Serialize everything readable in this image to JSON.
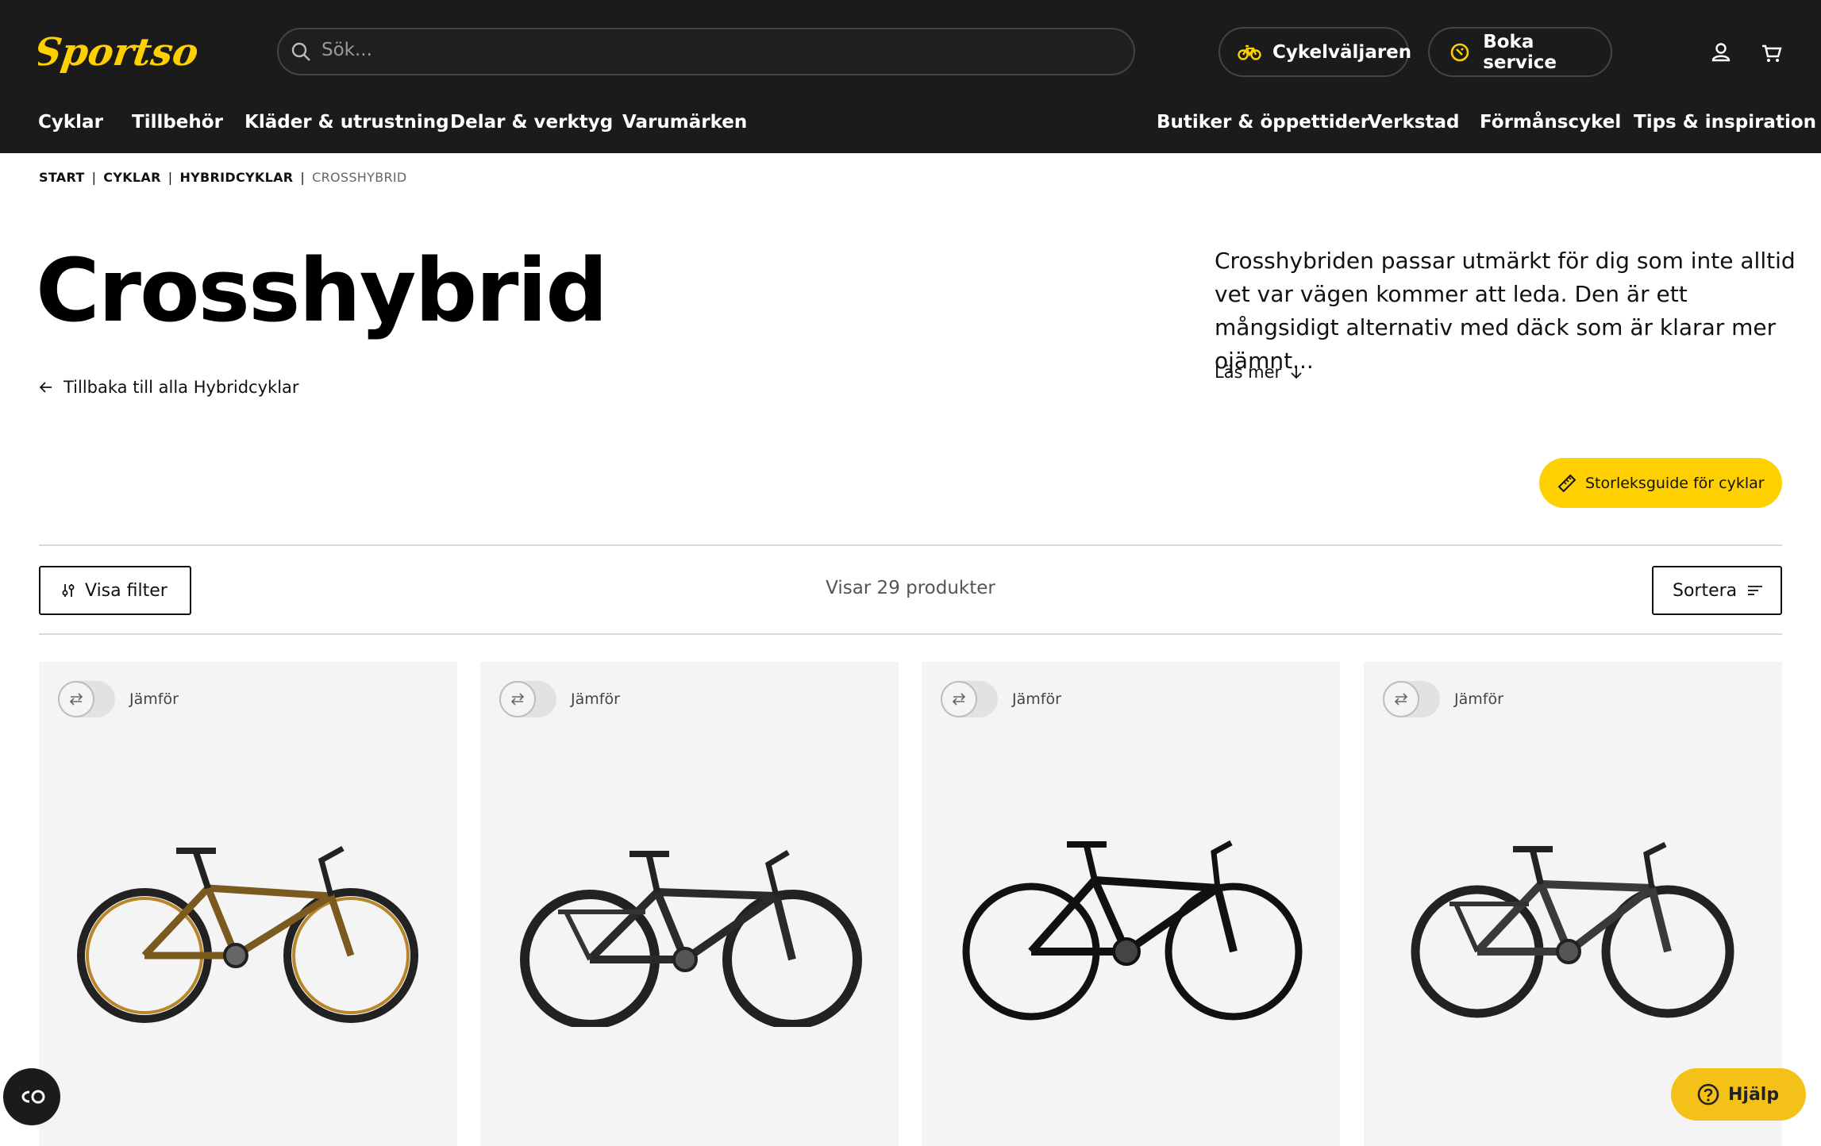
{
  "header": {
    "logo_text": "Sportson",
    "search_placeholder": "Sök...",
    "bike_finder_label": "Cykelväljaren",
    "book_service_label": "Boka service",
    "account_icon": "user-icon",
    "cart_icon": "cart-icon"
  },
  "nav_left": [
    "Cyklar",
    "Tillbehör",
    "Kläder & utrustning",
    "Delar & verktyg",
    "Varumärken"
  ],
  "nav_right": [
    "Butiker & öppettider",
    "Verkstad",
    "Förmånscykel",
    "Tips & inspiration"
  ],
  "breadcrumb": [
    "START",
    "CYKLAR",
    "HYBRIDCYKLAR",
    "CROSSHYBRID"
  ],
  "page": {
    "title": "Crosshybrid",
    "back_link": "Tillbaka till alla Hybridcyklar",
    "description": "Crosshybriden passar utmärkt för dig som inte alltid vet var vägen kommer att leda. Den är ett mångsidigt alternativ med däck som är klarar mer ojämnt...",
    "read_more": "Läs mer",
    "size_guide": "Storleksguide för cyklar"
  },
  "toolbar": {
    "filter_label": "Visa filter",
    "result_count": "Visar 29 produkter",
    "sort_label": "Sortera"
  },
  "products": [
    {
      "compare_label": "Jämför",
      "frame_color": "#7a5a1e",
      "rim_color": "#b8862a"
    },
    {
      "compare_label": "Jämför",
      "frame_color": "#2a2a2a",
      "rim_color": "#2a2a2a"
    },
    {
      "compare_label": "Jämför",
      "frame_color": "#111111",
      "rim_color": "#111111"
    },
    {
      "compare_label": "Jämför",
      "frame_color": "#3a3a3a",
      "rim_color": "#2a2a2a"
    }
  ],
  "floating": {
    "cookie_icon": "cookie-settings-icon",
    "help_label": "Hjälp"
  },
  "colors": {
    "header_bg": "#1b1b1b",
    "accent_yellow": "#ffd000",
    "card_bg": "#f4f4f4"
  }
}
